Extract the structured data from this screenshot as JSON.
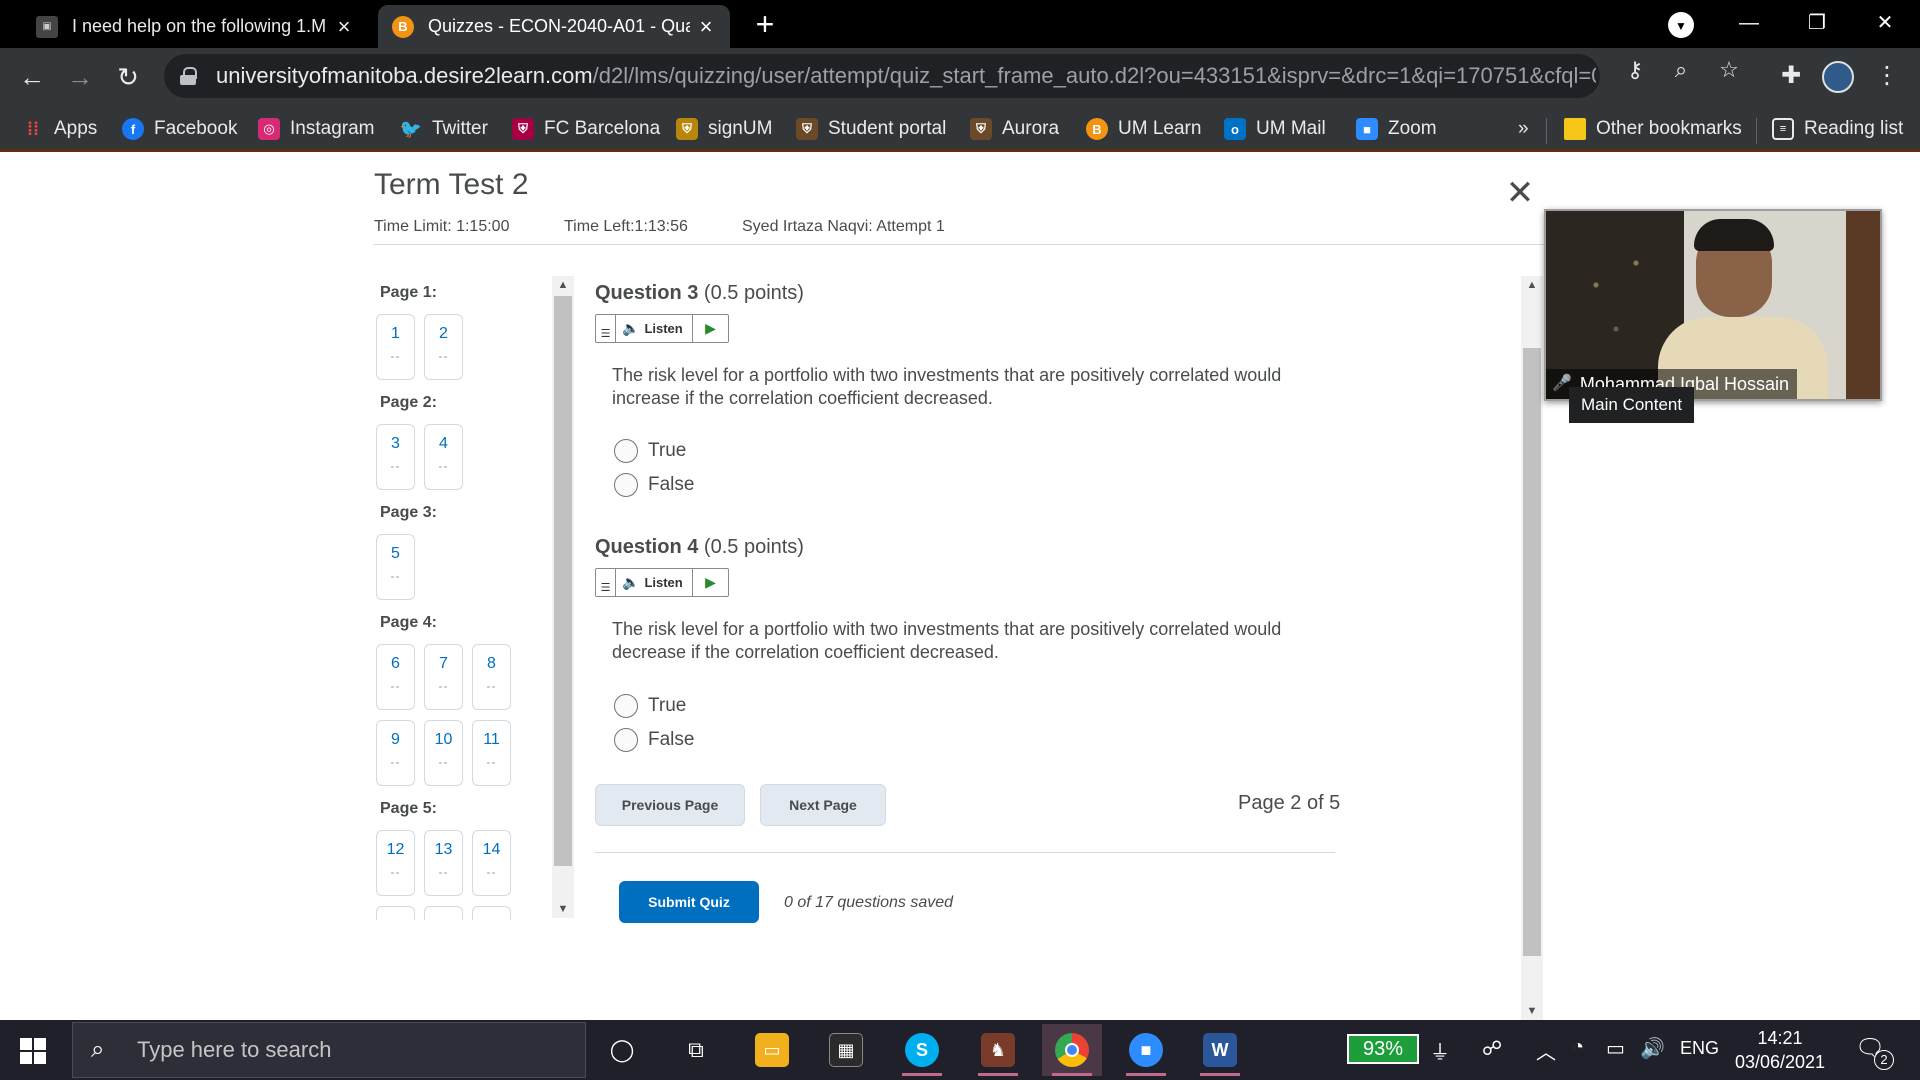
{
  "browser": {
    "tabs": [
      {
        "title": "I need help on the following 1.M",
        "active": false
      },
      {
        "title": "Quizzes - ECON-2040-A01 - Qua",
        "active": true
      }
    ],
    "url_host": "universityofmanitoba.desire2learn.com",
    "url_path": "/d2l/lms/quizzing/user/attempt/quiz_start_frame_auto.d2l?ou=433151&isprv=&drc=1&qi=170751&cfql=0&...",
    "bookmarks": [
      {
        "label": "Apps",
        "icon": "apps-grid-icon"
      },
      {
        "label": "Facebook",
        "icon": "facebook-icon"
      },
      {
        "label": "Instagram",
        "icon": "instagram-icon"
      },
      {
        "label": "Twitter",
        "icon": "twitter-icon"
      },
      {
        "label": "FC Barcelona",
        "icon": "barcelona-icon"
      },
      {
        "label": "signUM",
        "icon": "signum-icon"
      },
      {
        "label": "Student portal",
        "icon": "portal-icon"
      },
      {
        "label": "Aurora",
        "icon": "aurora-icon"
      },
      {
        "label": "UM Learn",
        "icon": "umlearn-icon"
      },
      {
        "label": "UM Mail",
        "icon": "outlook-icon"
      },
      {
        "label": "Zoom",
        "icon": "zoom-icon"
      }
    ],
    "bookmarks_overflow": "»",
    "other_bookmarks": "Other bookmarks",
    "reading_list": "Reading list"
  },
  "quiz": {
    "title": "Term Test 2",
    "time_limit": "Time Limit: 1:15:00",
    "time_left": "Time Left:1:13:56",
    "attempt": "Syed Irtaza Naqvi: Attempt 1",
    "nav_pages": [
      {
        "label": "Page 1:",
        "questions": [
          "1",
          "2"
        ]
      },
      {
        "label": "Page 2:",
        "questions": [
          "3",
          "4"
        ]
      },
      {
        "label": "Page 3:",
        "questions": [
          "5"
        ]
      },
      {
        "label": "Page 4:",
        "questions": [
          "6",
          "7",
          "8",
          "9",
          "10",
          "11"
        ]
      },
      {
        "label": "Page 5:",
        "questions": [
          "12",
          "13",
          "14"
        ]
      }
    ],
    "unanswered_mark": "--",
    "listen_label": "Listen",
    "questions": [
      {
        "number": "Question 3",
        "points": "(0.5 points)",
        "text": "The risk level for a portfolio with two investments that are positively correlated would increase if the correlation coefficient decreased.",
        "options": [
          "True",
          "False"
        ]
      },
      {
        "number": "Question 4",
        "points": "(0.5 points)",
        "text": "The risk level for a portfolio with two investments that are positively correlated would decrease if the correlation coefficient decreased.",
        "options": [
          "True",
          "False"
        ]
      }
    ],
    "previous_page": "Previous Page",
    "next_page": "Next Page",
    "page_indicator": "Page 2 of 5",
    "submit": "Submit Quiz",
    "saved_status": "0 of 17 questions saved"
  },
  "video": {
    "participant": "Mohammad Iqbal Hossain"
  },
  "tooltip": "Main Content",
  "taskbar": {
    "search_placeholder": "Type here to search",
    "battery": "93%",
    "language": "ENG",
    "time": "14:21",
    "date": "03/06/2021",
    "notifications": "2"
  }
}
